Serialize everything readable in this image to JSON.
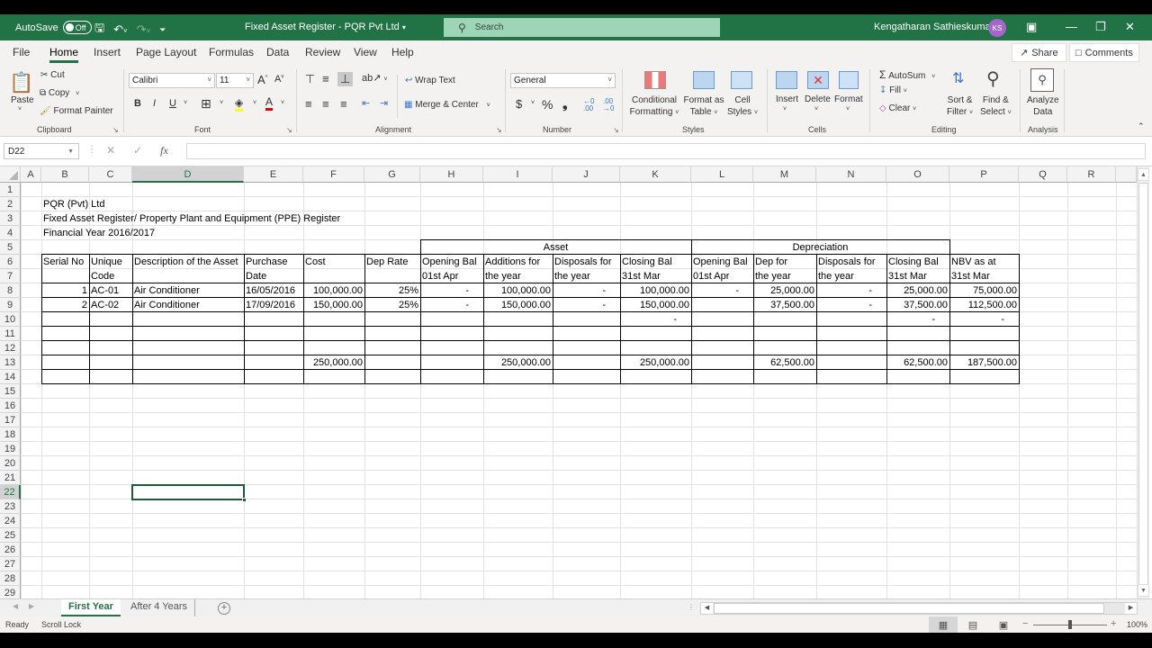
{
  "titlebar": {
    "autosave_label": "AutoSave",
    "autosave_state": "Off",
    "doc_title": "Fixed Asset Register - PQR Pvt Ltd",
    "search_placeholder": "Search",
    "user_name": "Kengatharan Sathieskumar",
    "user_initials": "KS"
  },
  "menu": {
    "tabs": [
      "File",
      "Home",
      "Insert",
      "Page Layout",
      "Formulas",
      "Data",
      "Review",
      "View",
      "Help"
    ],
    "active_tab": "Home",
    "share_label": "Share",
    "comments_label": "Comments"
  },
  "ribbon": {
    "clipboard": {
      "paste": "Paste",
      "cut": "Cut",
      "copy": "Copy",
      "format_painter": "Format Painter",
      "label": "Clipboard"
    },
    "font": {
      "font_name": "Calibri",
      "font_size": "11",
      "bold": "B",
      "italic": "I",
      "underline": "U",
      "label": "Font",
      "fill_color": "#ffff00",
      "font_color": "#e00000"
    },
    "alignment": {
      "wrap_text": "Wrap Text",
      "merge_center": "Merge & Center",
      "label": "Alignment"
    },
    "number": {
      "format": "General",
      "currency": "$",
      "percent": "%",
      "comma": "❟",
      "label": "Number"
    },
    "styles": {
      "conditional": [
        "Conditional",
        "Formatting"
      ],
      "format_table": [
        "Format as",
        "Table"
      ],
      "cell_styles": [
        "Cell",
        "Styles"
      ],
      "label": "Styles"
    },
    "cells": {
      "insert": "Insert",
      "delete": "Delete",
      "format": "Format",
      "label": "Cells"
    },
    "editing": {
      "autosum": "AutoSum",
      "fill": "Fill",
      "clear": "Clear",
      "sort_filter": [
        "Sort &",
        "Filter"
      ],
      "find_select": [
        "Find &",
        "Select"
      ],
      "label": "Editing"
    },
    "analysis": {
      "analyze": [
        "Analyze",
        "Data"
      ],
      "label": "Analysis"
    }
  },
  "formula_bar": {
    "name_box": "D22",
    "formula": ""
  },
  "sheet": {
    "columns": [
      "A",
      "B",
      "C",
      "D",
      "E",
      "F",
      "G",
      "H",
      "I",
      "J",
      "K",
      "L",
      "M",
      "N",
      "O",
      "P",
      "Q",
      "R"
    ],
    "selected_column": "D",
    "selected_row": 22,
    "selected_cell": "D22",
    "row_count": 29,
    "header_lines": {
      "company": "PQR (Pvt) Ltd",
      "register_title": "Fixed Asset Register/ Property Plant and Equipment (PPE) Register",
      "financial_year": "Financial Year 2016/2017"
    },
    "group_headers": {
      "asset": "Asset",
      "depreciation": "Depreciation"
    },
    "column_headers": {
      "B": [
        "Serial No",
        ""
      ],
      "C": [
        "Unique",
        "Code"
      ],
      "D": [
        "Description of the Asset",
        ""
      ],
      "E": [
        "Purchase",
        "Date"
      ],
      "F": [
        "Cost",
        ""
      ],
      "G": [
        "Dep Rate",
        ""
      ],
      "H": [
        "Opening Bal",
        "01st Apr"
      ],
      "I": [
        "Additions for",
        "the year"
      ],
      "J": [
        "Disposals for",
        "the year"
      ],
      "K": [
        "Closing Bal",
        "31st Mar"
      ],
      "L": [
        "Opening Bal",
        "01st Apr"
      ],
      "M": [
        "Dep for",
        "the year"
      ],
      "N": [
        "Disposals for",
        "the year"
      ],
      "O": [
        "Closing Bal",
        "31st Mar"
      ],
      "P": [
        "NBV as at",
        "31st Mar"
      ]
    },
    "rows": [
      {
        "row": 8,
        "B": "1",
        "C": "AC-01",
        "D": "Air Conditioner",
        "E": "16/05/2016",
        "F": "100,000.00",
        "G": "25%",
        "H": "-",
        "I": "100,000.00",
        "J": "-",
        "K": "100,000.00",
        "L": "-",
        "M": "25,000.00",
        "N": "-",
        "O": "25,000.00",
        "P": "75,000.00"
      },
      {
        "row": 9,
        "B": "2",
        "C": "AC-02",
        "D": "Air Conditioner",
        "E": "17/09/2016",
        "F": "150,000.00",
        "G": "25%",
        "H": "-",
        "I": "150,000.00",
        "J": "-",
        "K": "150,000.00",
        "L": "",
        "M": "37,500.00",
        "N": "-",
        "O": "37,500.00",
        "P": "112,500.00"
      },
      {
        "row": 10,
        "K": "-",
        "O": "-",
        "P": "-"
      },
      {
        "row": 13,
        "F": "250,000.00",
        "I": "250,000.00",
        "K": "250,000.00",
        "M": "62,500.00",
        "O": "62,500.00",
        "P": "187,500.00"
      }
    ]
  },
  "sheet_tabs": {
    "tabs": [
      "First Year",
      "After 4 Years"
    ],
    "active": "First Year"
  },
  "status": {
    "ready": "Ready",
    "scroll_lock": "Scroll Lock",
    "zoom": "100%",
    "zoom_fraction": 0.5
  }
}
